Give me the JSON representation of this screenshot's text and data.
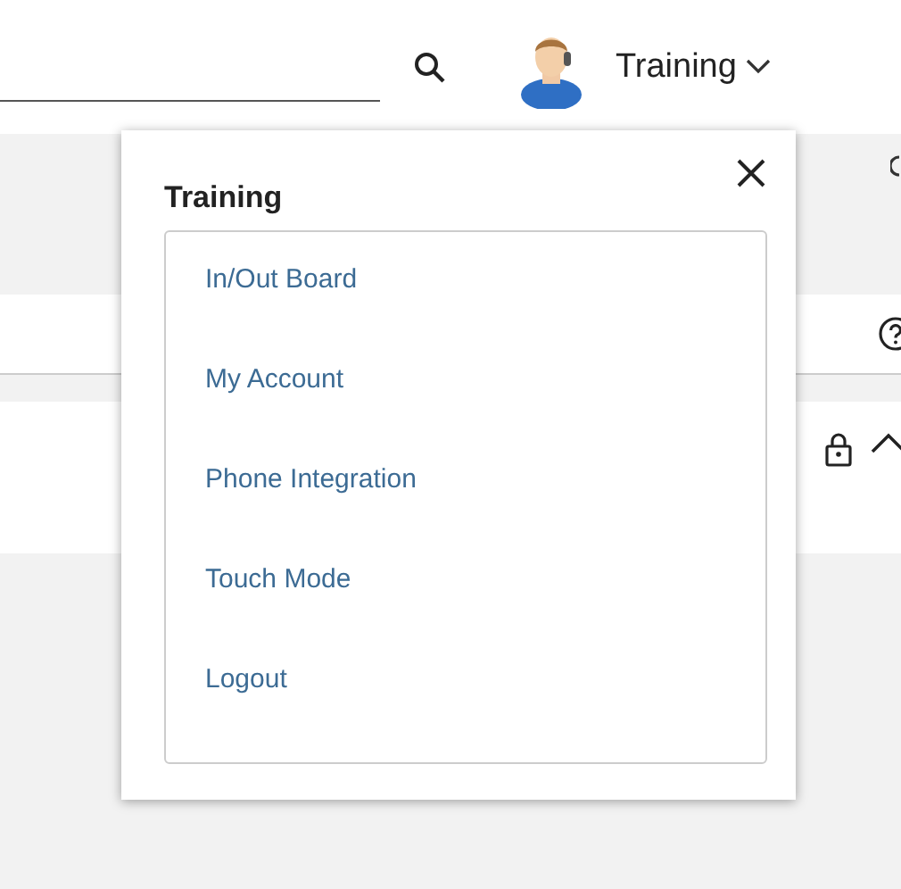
{
  "header": {
    "user_name": "Training"
  },
  "user_menu": {
    "title": "Training",
    "items": [
      {
        "label": "In/Out Board"
      },
      {
        "label": "My Account"
      },
      {
        "label": "Phone Integration"
      },
      {
        "label": "Touch Mode"
      },
      {
        "label": "Logout"
      }
    ]
  }
}
